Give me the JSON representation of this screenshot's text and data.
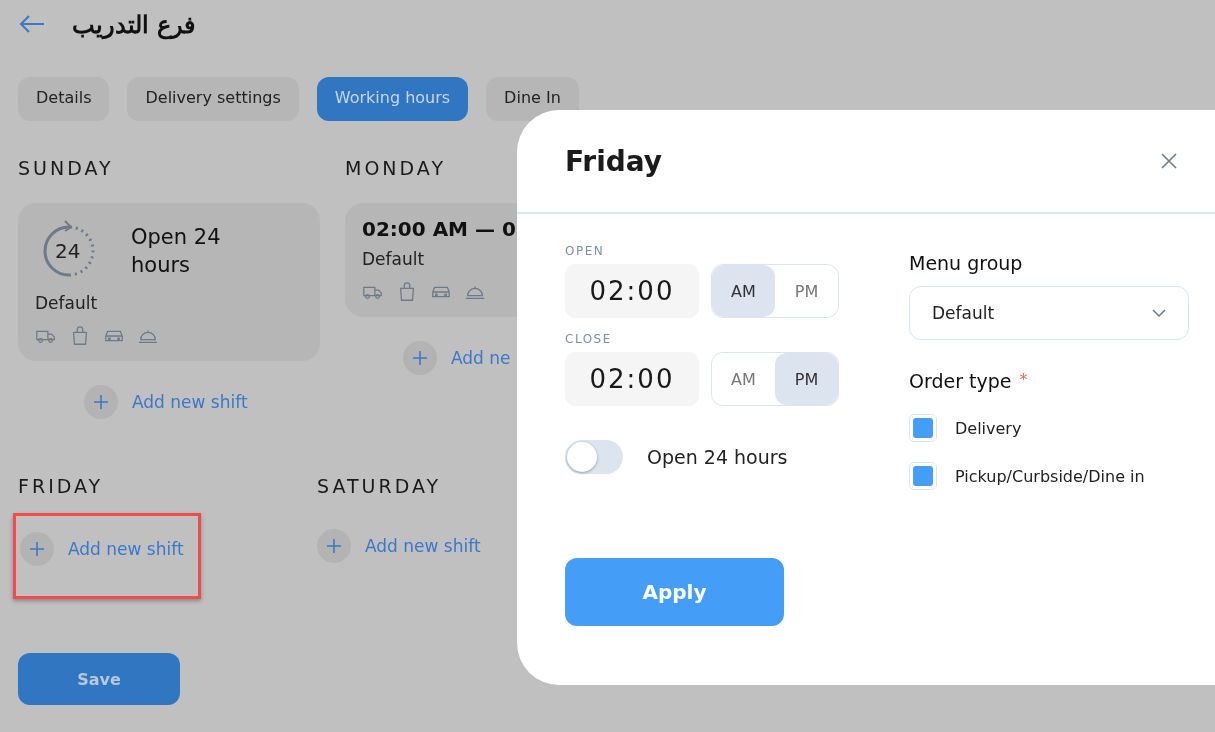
{
  "header": {
    "title": "فرع التدريب"
  },
  "tabs": [
    {
      "label": "Details",
      "selected": false
    },
    {
      "label": "Delivery settings",
      "selected": false
    },
    {
      "label": "Working hours",
      "selected": true
    },
    {
      "label": "Dine In",
      "selected": false
    }
  ],
  "days": [
    {
      "name": "SUNDAY",
      "highlighted": false,
      "shifts": [
        {
          "kind": "all_day",
          "badge": "24",
          "title": "Open 24 hours",
          "menu": "Default"
        }
      ],
      "add_label": "Add new shift"
    },
    {
      "name": "MONDAY",
      "highlighted": false,
      "shifts": [
        {
          "kind": "timed",
          "time": "02:00 AM — 0",
          "menu": "Default"
        }
      ],
      "add_label": "Add ne"
    },
    {
      "name": "FRIDAY",
      "highlighted": true,
      "add_label": "Add new shift"
    },
    {
      "name": "SATURDAY",
      "highlighted": false,
      "add_label": "Add new shift"
    }
  ],
  "save_label": "Save",
  "modal": {
    "title": "Friday",
    "times": [
      {
        "label": "OPEN",
        "time": "02:00",
        "periods": [
          {
            "label": "AM",
            "selected": true
          },
          {
            "label": "PM",
            "selected": false
          }
        ]
      },
      {
        "label": "CLOSE",
        "time": "02:00",
        "periods": [
          {
            "label": "AM",
            "selected": false
          },
          {
            "label": "PM",
            "selected": true
          }
        ]
      }
    ],
    "toggle": {
      "label": "Open 24 hours",
      "on": false
    },
    "menu_group": {
      "label": "Menu group",
      "value": "Default"
    },
    "order_type": {
      "label": "Order type",
      "required_mark": "*",
      "options": [
        {
          "label": "Delivery",
          "checked": true
        },
        {
          "label": "Pickup/Curbside/Dine in",
          "checked": true
        }
      ]
    },
    "apply_label": "Apply"
  }
}
